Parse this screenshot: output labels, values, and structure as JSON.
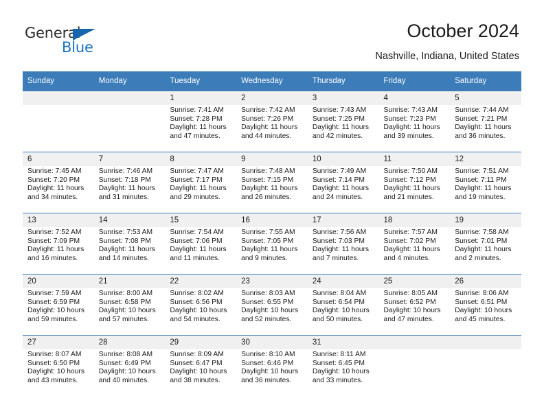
{
  "brand": {
    "name_part1": "General",
    "name_part2": "Blue",
    "triangle_icon": "triangle-icon",
    "color_primary": "#1872c4",
    "color_triangle": "#1565b0"
  },
  "header": {
    "title": "October 2024",
    "subtitle": "Nashville, Indiana, United States"
  },
  "colors": {
    "header_row_bg": "#3b7cb9",
    "daynum_bg": "#f0f0f0",
    "text": "#1a1a1a"
  },
  "weekday_headers": [
    "Sunday",
    "Monday",
    "Tuesday",
    "Wednesday",
    "Thursday",
    "Friday",
    "Saturday"
  ],
  "weeks": [
    [
      {
        "day": "",
        "sunrise": "",
        "sunset": "",
        "daylight_line1": "",
        "daylight_line2": "",
        "blank": true
      },
      {
        "day": "",
        "sunrise": "",
        "sunset": "",
        "daylight_line1": "",
        "daylight_line2": "",
        "blank": true
      },
      {
        "day": "1",
        "sunrise": "Sunrise: 7:41 AM",
        "sunset": "Sunset: 7:28 PM",
        "daylight_line1": "Daylight: 11 hours",
        "daylight_line2": "and 47 minutes.",
        "blank": false
      },
      {
        "day": "2",
        "sunrise": "Sunrise: 7:42 AM",
        "sunset": "Sunset: 7:26 PM",
        "daylight_line1": "Daylight: 11 hours",
        "daylight_line2": "and 44 minutes.",
        "blank": false
      },
      {
        "day": "3",
        "sunrise": "Sunrise: 7:43 AM",
        "sunset": "Sunset: 7:25 PM",
        "daylight_line1": "Daylight: 11 hours",
        "daylight_line2": "and 42 minutes.",
        "blank": false
      },
      {
        "day": "4",
        "sunrise": "Sunrise: 7:43 AM",
        "sunset": "Sunset: 7:23 PM",
        "daylight_line1": "Daylight: 11 hours",
        "daylight_line2": "and 39 minutes.",
        "blank": false
      },
      {
        "day": "5",
        "sunrise": "Sunrise: 7:44 AM",
        "sunset": "Sunset: 7:21 PM",
        "daylight_line1": "Daylight: 11 hours",
        "daylight_line2": "and 36 minutes.",
        "blank": false
      }
    ],
    [
      {
        "day": "6",
        "sunrise": "Sunrise: 7:45 AM",
        "sunset": "Sunset: 7:20 PM",
        "daylight_line1": "Daylight: 11 hours",
        "daylight_line2": "and 34 minutes.",
        "blank": false
      },
      {
        "day": "7",
        "sunrise": "Sunrise: 7:46 AM",
        "sunset": "Sunset: 7:18 PM",
        "daylight_line1": "Daylight: 11 hours",
        "daylight_line2": "and 31 minutes.",
        "blank": false
      },
      {
        "day": "8",
        "sunrise": "Sunrise: 7:47 AM",
        "sunset": "Sunset: 7:17 PM",
        "daylight_line1": "Daylight: 11 hours",
        "daylight_line2": "and 29 minutes.",
        "blank": false
      },
      {
        "day": "9",
        "sunrise": "Sunrise: 7:48 AM",
        "sunset": "Sunset: 7:15 PM",
        "daylight_line1": "Daylight: 11 hours",
        "daylight_line2": "and 26 minutes.",
        "blank": false
      },
      {
        "day": "10",
        "sunrise": "Sunrise: 7:49 AM",
        "sunset": "Sunset: 7:14 PM",
        "daylight_line1": "Daylight: 11 hours",
        "daylight_line2": "and 24 minutes.",
        "blank": false
      },
      {
        "day": "11",
        "sunrise": "Sunrise: 7:50 AM",
        "sunset": "Sunset: 7:12 PM",
        "daylight_line1": "Daylight: 11 hours",
        "daylight_line2": "and 21 minutes.",
        "blank": false
      },
      {
        "day": "12",
        "sunrise": "Sunrise: 7:51 AM",
        "sunset": "Sunset: 7:11 PM",
        "daylight_line1": "Daylight: 11 hours",
        "daylight_line2": "and 19 minutes.",
        "blank": false
      }
    ],
    [
      {
        "day": "13",
        "sunrise": "Sunrise: 7:52 AM",
        "sunset": "Sunset: 7:09 PM",
        "daylight_line1": "Daylight: 11 hours",
        "daylight_line2": "and 16 minutes.",
        "blank": false
      },
      {
        "day": "14",
        "sunrise": "Sunrise: 7:53 AM",
        "sunset": "Sunset: 7:08 PM",
        "daylight_line1": "Daylight: 11 hours",
        "daylight_line2": "and 14 minutes.",
        "blank": false
      },
      {
        "day": "15",
        "sunrise": "Sunrise: 7:54 AM",
        "sunset": "Sunset: 7:06 PM",
        "daylight_line1": "Daylight: 11 hours",
        "daylight_line2": "and 11 minutes.",
        "blank": false
      },
      {
        "day": "16",
        "sunrise": "Sunrise: 7:55 AM",
        "sunset": "Sunset: 7:05 PM",
        "daylight_line1": "Daylight: 11 hours",
        "daylight_line2": "and 9 minutes.",
        "blank": false
      },
      {
        "day": "17",
        "sunrise": "Sunrise: 7:56 AM",
        "sunset": "Sunset: 7:03 PM",
        "daylight_line1": "Daylight: 11 hours",
        "daylight_line2": "and 7 minutes.",
        "blank": false
      },
      {
        "day": "18",
        "sunrise": "Sunrise: 7:57 AM",
        "sunset": "Sunset: 7:02 PM",
        "daylight_line1": "Daylight: 11 hours",
        "daylight_line2": "and 4 minutes.",
        "blank": false
      },
      {
        "day": "19",
        "sunrise": "Sunrise: 7:58 AM",
        "sunset": "Sunset: 7:01 PM",
        "daylight_line1": "Daylight: 11 hours",
        "daylight_line2": "and 2 minutes.",
        "blank": false
      }
    ],
    [
      {
        "day": "20",
        "sunrise": "Sunrise: 7:59 AM",
        "sunset": "Sunset: 6:59 PM",
        "daylight_line1": "Daylight: 10 hours",
        "daylight_line2": "and 59 minutes.",
        "blank": false
      },
      {
        "day": "21",
        "sunrise": "Sunrise: 8:00 AM",
        "sunset": "Sunset: 6:58 PM",
        "daylight_line1": "Daylight: 10 hours",
        "daylight_line2": "and 57 minutes.",
        "blank": false
      },
      {
        "day": "22",
        "sunrise": "Sunrise: 8:02 AM",
        "sunset": "Sunset: 6:56 PM",
        "daylight_line1": "Daylight: 10 hours",
        "daylight_line2": "and 54 minutes.",
        "blank": false
      },
      {
        "day": "23",
        "sunrise": "Sunrise: 8:03 AM",
        "sunset": "Sunset: 6:55 PM",
        "daylight_line1": "Daylight: 10 hours",
        "daylight_line2": "and 52 minutes.",
        "blank": false
      },
      {
        "day": "24",
        "sunrise": "Sunrise: 8:04 AM",
        "sunset": "Sunset: 6:54 PM",
        "daylight_line1": "Daylight: 10 hours",
        "daylight_line2": "and 50 minutes.",
        "blank": false
      },
      {
        "day": "25",
        "sunrise": "Sunrise: 8:05 AM",
        "sunset": "Sunset: 6:52 PM",
        "daylight_line1": "Daylight: 10 hours",
        "daylight_line2": "and 47 minutes.",
        "blank": false
      },
      {
        "day": "26",
        "sunrise": "Sunrise: 8:06 AM",
        "sunset": "Sunset: 6:51 PM",
        "daylight_line1": "Daylight: 10 hours",
        "daylight_line2": "and 45 minutes.",
        "blank": false
      }
    ],
    [
      {
        "day": "27",
        "sunrise": "Sunrise: 8:07 AM",
        "sunset": "Sunset: 6:50 PM",
        "daylight_line1": "Daylight: 10 hours",
        "daylight_line2": "and 43 minutes.",
        "blank": false
      },
      {
        "day": "28",
        "sunrise": "Sunrise: 8:08 AM",
        "sunset": "Sunset: 6:49 PM",
        "daylight_line1": "Daylight: 10 hours",
        "daylight_line2": "and 40 minutes.",
        "blank": false
      },
      {
        "day": "29",
        "sunrise": "Sunrise: 8:09 AM",
        "sunset": "Sunset: 6:47 PM",
        "daylight_line1": "Daylight: 10 hours",
        "daylight_line2": "and 38 minutes.",
        "blank": false
      },
      {
        "day": "30",
        "sunrise": "Sunrise: 8:10 AM",
        "sunset": "Sunset: 6:46 PM",
        "daylight_line1": "Daylight: 10 hours",
        "daylight_line2": "and 36 minutes.",
        "blank": false
      },
      {
        "day": "31",
        "sunrise": "Sunrise: 8:11 AM",
        "sunset": "Sunset: 6:45 PM",
        "daylight_line1": "Daylight: 10 hours",
        "daylight_line2": "and 33 minutes.",
        "blank": false
      },
      {
        "day": "",
        "sunrise": "",
        "sunset": "",
        "daylight_line1": "",
        "daylight_line2": "",
        "blank": true
      },
      {
        "day": "",
        "sunrise": "",
        "sunset": "",
        "daylight_line1": "",
        "daylight_line2": "",
        "blank": true
      }
    ]
  ]
}
